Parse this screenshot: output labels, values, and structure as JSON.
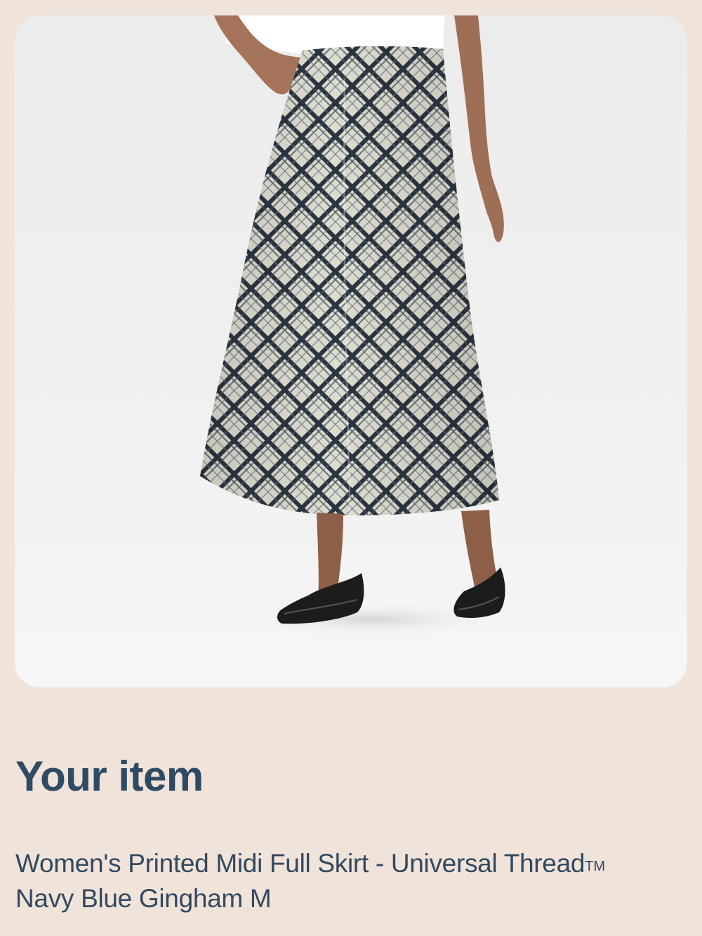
{
  "colors": {
    "page_background": "#f0e3da",
    "card_background": "#f2f2f2",
    "heading_text": "#2f4a63",
    "body_text": "#34495e",
    "plaid_base": "#dcdcd0",
    "plaid_navy": "#2b3440"
  },
  "product_image": {
    "description_icon": "product-photo"
  },
  "item_section": {
    "heading": "Your item",
    "title_main": "Women's Printed Midi Full Skirt - Universal Thread",
    "trademark": "TM",
    "variant": "Navy Blue Gingham M"
  }
}
